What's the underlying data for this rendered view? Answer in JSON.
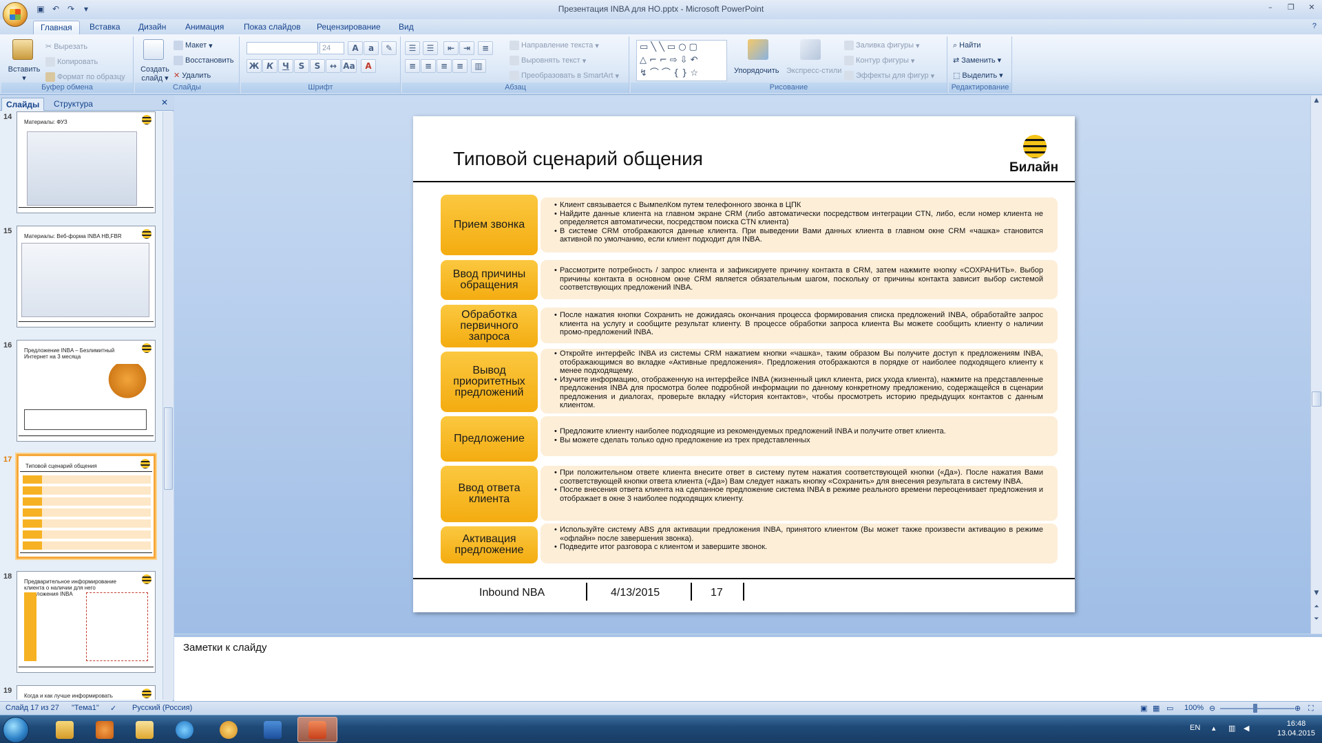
{
  "window": {
    "title": "Презентация INBA для НО.pptx - Microsoft PowerPoint"
  },
  "ribbon": {
    "tabs": [
      "Главная",
      "Вставка",
      "Дизайн",
      "Анимация",
      "Показ слайдов",
      "Рецензирование",
      "Вид"
    ],
    "clipboard": {
      "paste": "Вставить",
      "cut": "Вырезать",
      "copy": "Копировать",
      "format_painter": "Формат по образцу",
      "label": "Буфер обмена"
    },
    "slides": {
      "new_slide": "Создать слайд",
      "layout": "Макет",
      "reset": "Восстановить",
      "delete": "Удалить",
      "label": "Слайды"
    },
    "font": {
      "size": "24",
      "label": "Шрифт"
    },
    "paragraph": {
      "text_direction": "Направление текста",
      "align_text": "Выровнять текст",
      "smartart": "Преобразовать в SmartArt",
      "label": "Абзац"
    },
    "drawing": {
      "arrange": "Упорядочить",
      "quick_styles": "Экспресс-стили",
      "fill": "Заливка фигуры",
      "outline": "Контур фигуры",
      "effects": "Эффекты для фигур",
      "label": "Рисование"
    },
    "editing": {
      "find": "Найти",
      "replace": "Заменить",
      "select": "Выделить",
      "label": "Редактирование"
    }
  },
  "left_pane": {
    "tabs": [
      "Слайды",
      "Структура"
    ],
    "thumbs": [
      {
        "num": "14",
        "title": "Материалы: ФУЗ"
      },
      {
        "num": "15",
        "title": "Материалы: Веб-форма INBA HB,FBR"
      },
      {
        "num": "16",
        "title": "Предложение INBA – Безлимитный Интернет на 3 месяца"
      },
      {
        "num": "17",
        "title": "Типовой сценарий общения"
      },
      {
        "num": "18",
        "title": "Предварительное информирование клиента о наличии для него предложения INBA"
      },
      {
        "num": "19",
        "title": "Когда и как лучше информировать клиента о наличии предложения INBA"
      }
    ]
  },
  "slide": {
    "title": "Типовой сценарий общения",
    "logo_text": "Билайн",
    "rows": [
      {
        "label": "Прием звонка",
        "items": [
          "Клиент связывается с ВымпелКом путем телефонного звонка в ЦПК",
          "Найдите данные клиента на главном экране CRM (либо автоматически посредством интеграции CTN, либо, если номер клиента не определяется автоматически, посредством поиска CTN клиента)",
          "В системе CRM отображаются данные клиента. При выведении Вами данных клиента в главном окне CRM «чашка» становится активной по умолчанию, если клиент подходит для INBA."
        ]
      },
      {
        "label": "Ввод причины обращения",
        "items": [
          "Рассмотрите потребность / запрос клиента и зафиксируете причину контакта в CRM, затем нажмите кнопку «СОХРАНИТЬ». Выбор причины контакта в основном окне CRM является обязательным шагом, поскольку от причины контакта зависит выбор системой соответствующих предложений INBA."
        ]
      },
      {
        "label": "Обработка первичного запроса",
        "items": [
          "После нажатия кнопки Сохранить не дожидаясь окончания процесса формирования списка предложений INBA, обработайте запрос клиента на услугу и сообщите результат клиенту. В процессе обработки запроса клиента Вы можете сообщить клиенту о наличии промо-предложений INBA."
        ]
      },
      {
        "label": "Вывод приоритетных предложений",
        "items": [
          "Откройте интерфейс INBA из системы CRM нажатием кнопки «чашка», таким образом Вы получите доступ к предложениям INBA, отображающимся во вкладке «Активные предложения». Предложения отображаются в порядке от наиболее подходящего клиенту к менее подходящему.",
          "Изучите информацию, отображенную на интерфейсе INBA (жизненный цикл клиента, риск ухода клиента), нажмите на представленные предложения INBA для просмотра более подробной информации по данному конкретному предложению, содержащейся в сценарии предложения и диалогах, проверьте вкладку «История контактов», чтобы просмотреть историю предыдущих контактов с данным клиентом."
        ]
      },
      {
        "label": "Предложение",
        "items": [
          "Предложите клиенту наиболее подходящие из рекомендуемых предложений INBA и получите ответ клиента.",
          "Вы можете сделать только одно предложение из трех представленных"
        ]
      },
      {
        "label": "Ввод ответа клиента",
        "items": [
          "При положительном ответе клиента внесите ответ в систему путем нажатия соответствующей кнопки («Да»). После нажатия Вами соответствующей кнопки ответа клиента («Да») Вам следует нажать кнопку «Сохранить» для внесения результата в систему INBA.",
          "После внесения ответа клиента на сделанное предложение система INBA в режиме реального времени переоценивает предложения и отображает в окне 3 наиболее подходящих клиенту."
        ]
      },
      {
        "label": "Активация предложение",
        "items": [
          "Используйте систему ABS для активации предложения INBA, принятого клиентом (Вы может также произвести активацию в режиме «офлайн» после завершения звонка).",
          "Подведите итог разговора с клиентом и завершите звонок."
        ]
      }
    ],
    "footer": {
      "left": "Inbound NBA",
      "date": "4/13/2015",
      "page": "17"
    }
  },
  "notes": {
    "placeholder": "Заметки к слайду"
  },
  "status": {
    "slide": "Слайд 17 из 27",
    "theme": "\"Тема1\"",
    "lang": "Русский (Россия)",
    "zoom": "100%"
  },
  "taskbar": {
    "lang": "EN",
    "time": "16:48",
    "date": "13.04.2015"
  }
}
